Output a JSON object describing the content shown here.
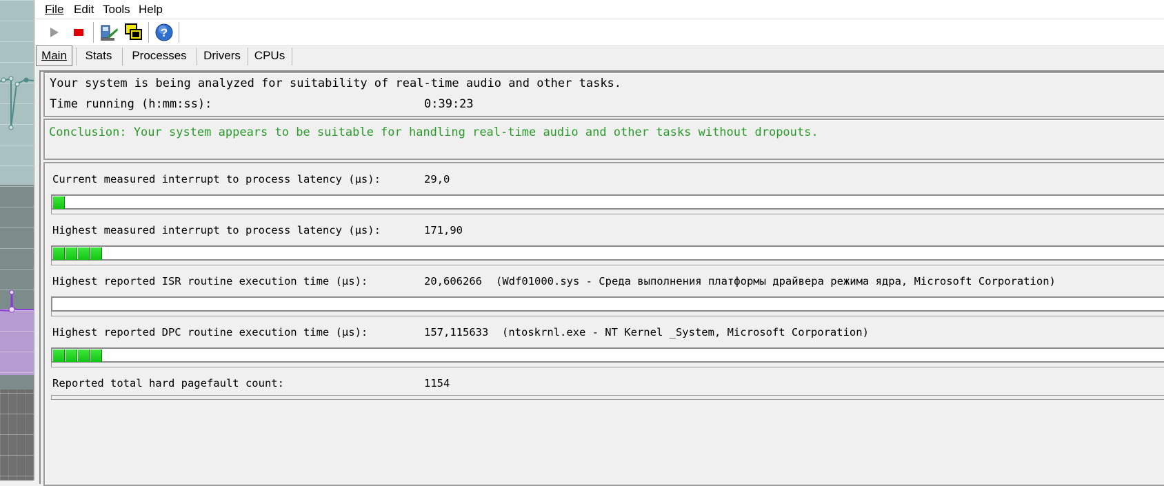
{
  "menu": {
    "items": [
      {
        "label": "File"
      },
      {
        "label": "Edit"
      },
      {
        "label": "Tools"
      },
      {
        "label": "Help"
      }
    ]
  },
  "toolbar": {
    "icons": [
      "play-icon",
      "stop-icon",
      "driver-properties-icon",
      "windows-icon",
      "help-icon"
    ]
  },
  "tabs": [
    {
      "label": "Main",
      "active": true
    },
    {
      "label": "Stats",
      "active": false
    },
    {
      "label": "Processes",
      "active": false
    },
    {
      "label": "Drivers",
      "active": false
    },
    {
      "label": "CPUs",
      "active": false
    }
  ],
  "status": {
    "analyzing": "Your system is being analyzed for suitability of real-time audio and other tasks.",
    "time_label": "Time running (h:mm:ss):",
    "time_value": "0:39:23"
  },
  "conclusion": "Conclusion: Your system appears to be suitable for handling real-time audio and other tasks without dropouts.",
  "metrics": [
    {
      "label": "Current measured interrupt to process latency (µs):",
      "value": "29,0",
      "detail": "",
      "bar_segments": 1
    },
    {
      "label": "Highest measured interrupt to process latency (µs):",
      "value": "171,90",
      "detail": "",
      "bar_segments": 4
    },
    {
      "label": "Highest reported ISR routine execution time (µs):",
      "value": "20,606266",
      "detail": "(Wdf01000.sys - Среда выполнения платформы драйвера режима ядра, Microsoft Corporation)",
      "bar_segments": 0
    },
    {
      "label": "Highest reported DPC routine execution time (µs):",
      "value": "157,115633",
      "detail": "(ntoskrnl.exe - NT Kernel _System, Microsoft Corporation)",
      "bar_segments": 4
    }
  ],
  "pagefault": {
    "label": "Reported total hard pagefault count:",
    "value": "1154"
  },
  "colors": {
    "conclusion_text": "#2a9a2a",
    "bar_fill": "#22d622",
    "stop": "#e00000"
  }
}
